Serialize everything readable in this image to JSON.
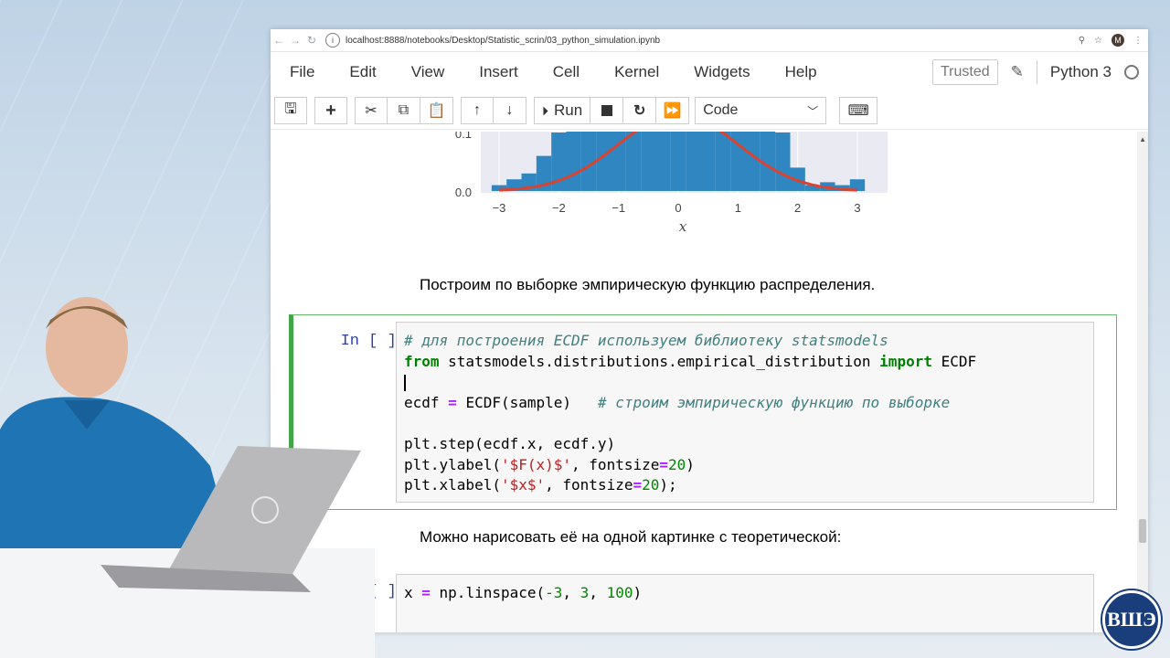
{
  "browser": {
    "url": "localhost:8888/notebooks/Desktop/Statistic_scrin/03_python_simulation.ipynb",
    "avatar_letter": "M"
  },
  "menu": {
    "items": [
      "File",
      "Edit",
      "View",
      "Insert",
      "Cell",
      "Kernel",
      "Widgets",
      "Help"
    ],
    "trusted": "Trusted",
    "kernel": "Python 3"
  },
  "toolbar": {
    "run_label": "Run",
    "cell_type": "Code"
  },
  "plot": {
    "y_ticks": [
      "0.1",
      "0.0"
    ],
    "x_ticks": [
      "−3",
      "−2",
      "−1",
      "0",
      "1",
      "2",
      "3"
    ],
    "xlabel": "x",
    "bar_color": "#2f86c1",
    "curve_color": "#d9432f"
  },
  "chart_data": {
    "type": "bar",
    "categories": [
      -3,
      -2.75,
      -2.5,
      -2.25,
      -2,
      -1.75,
      -1.5,
      -1.25,
      -1,
      -0.75,
      -0.5,
      -0.25,
      0,
      0.25,
      0.5,
      0.75,
      1,
      1.25,
      1.5,
      1.75,
      2,
      2.25,
      2.5,
      2.75,
      3
    ],
    "values": [
      0.01,
      0.02,
      0.03,
      0.06,
      0.1,
      0.12,
      0.11,
      0.13,
      0.13,
      0.13,
      0.13,
      0.13,
      0.13,
      0.13,
      0.13,
      0.13,
      0.13,
      0.13,
      0.12,
      0.1,
      0.04,
      0.01,
      0.015,
      0.01,
      0.02
    ],
    "xlabel": "x",
    "grid": true
  },
  "cells": {
    "md1": "Построим по выборке эмпирическую функцию распределения.",
    "prompt1": "In [ ]:",
    "code1": {
      "line1_comment": "# для построения ECDF используем библиотеку statsmodels",
      "line2_kw1": "from",
      "line2_mod": " statsmodels.distributions.empirical_distribution ",
      "line2_kw2": "import",
      "line2_name": " ECDF",
      "line4_a": "ecdf ",
      "line4_op": "=",
      "line4_b": " ECDF(sample)   ",
      "line4_comment": "# строим эмпирическую функцию по выборке",
      "line6": "plt.step(ecdf.x, ecdf.y)",
      "line7_a": "plt.ylabel(",
      "line7_str": "'$F(x)$'",
      "line7_b": ", fontsize",
      "line7_op": "=",
      "line7_num": "20",
      "line7_c": ")",
      "line8_a": "plt.xlabel(",
      "line8_str": "'$x$'",
      "line8_b": ", fontsize",
      "line8_op": "=",
      "line8_num": "20",
      "line8_c": ");"
    },
    "md2": "Можно нарисовать её на одной картинке с теоретической:",
    "prompt2": "[ ]:",
    "code2": {
      "line1_a": "x ",
      "line1_op": "=",
      "line1_b": " np.linspace(",
      "line1_n1": "-3",
      "line1_c": ", ",
      "line1_n2": "3",
      "line1_d": ", ",
      "line1_n3": "100",
      "line1_e": ")"
    }
  },
  "logo_text": "ВШЭ"
}
